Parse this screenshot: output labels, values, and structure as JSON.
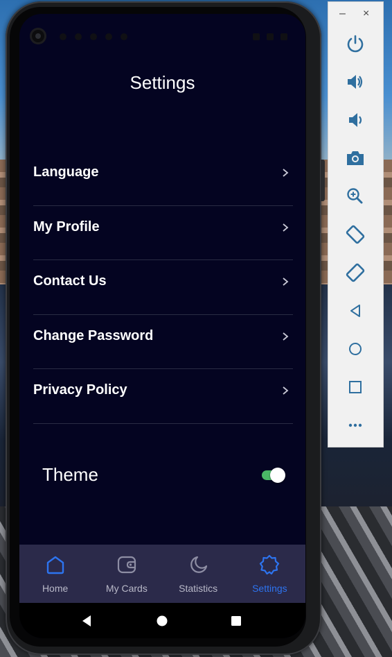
{
  "screen": {
    "title": "Settings",
    "settings_items": [
      {
        "label": "Language"
      },
      {
        "label": "My Profile"
      },
      {
        "label": "Contact Us"
      },
      {
        "label": "Change Password"
      },
      {
        "label": "Privacy Policy"
      }
    ],
    "theme": {
      "label": "Theme",
      "toggle_on": true
    }
  },
  "bottom_nav": {
    "items": [
      {
        "label": "Home",
        "icon": "home-icon",
        "active": false
      },
      {
        "label": "My Cards",
        "icon": "wallet-icon",
        "active": false
      },
      {
        "label": "Statistics",
        "icon": "moon-chart-icon",
        "active": false
      },
      {
        "label": "Settings",
        "icon": "gear-icon",
        "active": true
      }
    ]
  },
  "android_nav": {
    "back": "back-icon",
    "home": "home-circle-icon",
    "recents": "recents-square-icon"
  },
  "emulator_toolbar": {
    "minimize_label": "–",
    "close_label": "×",
    "buttons": [
      "power-icon",
      "volume-up-icon",
      "volume-down-icon",
      "camera-icon",
      "zoom-in-icon",
      "rotate-left-icon",
      "rotate-right-icon",
      "back-triangle-icon",
      "home-circle-icon",
      "overview-square-icon",
      "more-icon"
    ]
  },
  "colors": {
    "screen_background": "#040421",
    "nav_background": "#2b2a4a",
    "accent_active": "#2d74f0",
    "toggle_on": "#4ab866",
    "toolbar_icon": "#2f6f9f"
  }
}
